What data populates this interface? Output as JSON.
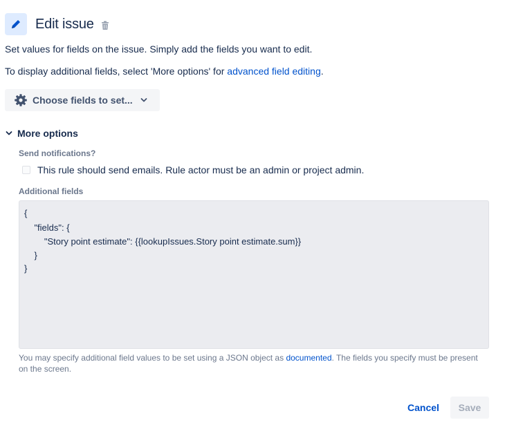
{
  "header": {
    "title": "Edit issue",
    "edit_icon": "pencil-icon",
    "delete_icon": "trash-icon"
  },
  "description": {
    "line1": "Set values for fields on the issue. Simply add the fields you want to edit.",
    "line2_prefix": "To display additional fields, select 'More options' for ",
    "line2_link": "advanced field editing",
    "line2_suffix": "."
  },
  "choose_fields": {
    "label": "Choose fields to set...",
    "icon": "gear-icon",
    "chevron": "chevron-down-icon"
  },
  "more_options": {
    "label": "More options",
    "expanded": true,
    "send_notifications": {
      "label": "Send notifications?",
      "checkbox_label": "This rule should send emails. Rule actor must be an admin or project admin.",
      "checked": false
    },
    "additional_fields": {
      "label": "Additional fields",
      "code_lines": [
        "{",
        "    \"fields\": {",
        "        \"Story point estimate\": {{lookupIssues.Story point estimate.sum}}",
        "    }",
        "}"
      ],
      "help_prefix": "You may specify additional field values to be set using a JSON object as ",
      "help_link": "documented",
      "help_suffix": ". The fields you specify must be present on the screen."
    }
  },
  "footer": {
    "cancel_label": "Cancel",
    "save_label": "Save",
    "save_enabled": false
  },
  "colors": {
    "link": "#0052CC",
    "text": "#172B4D",
    "muted": "#6B778C",
    "icon_bg": "#DEEBFF",
    "code_bg": "#EBECF0"
  }
}
